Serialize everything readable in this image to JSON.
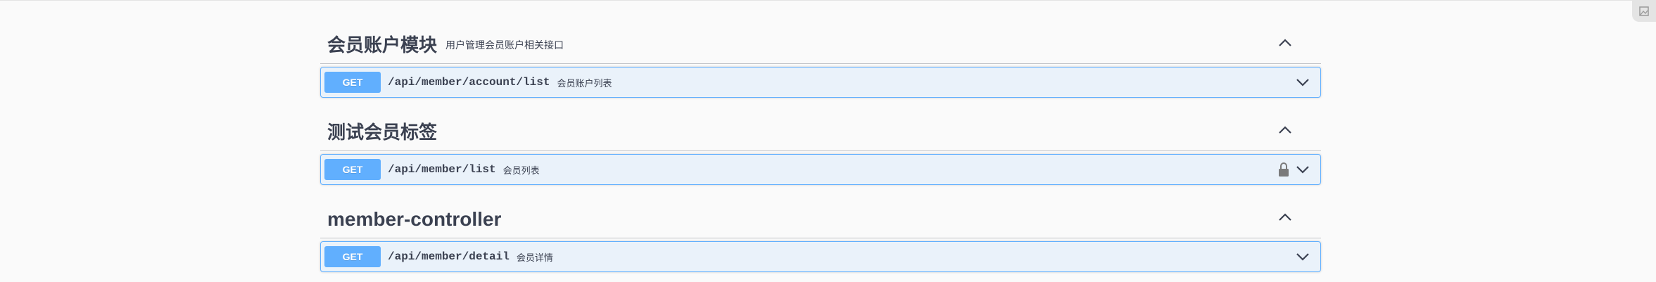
{
  "sections": [
    {
      "title": "会员账户模块",
      "description": "用户管理会员账户相关接口",
      "operations": [
        {
          "method": "GET",
          "path": "/api/member/account/list",
          "summary": "会员账户列表",
          "locked": false
        }
      ]
    },
    {
      "title": "测试会员标签",
      "description": "",
      "operations": [
        {
          "method": "GET",
          "path": "/api/member/list",
          "summary": "会员列表",
          "locked": true
        }
      ]
    },
    {
      "title": "member-controller",
      "description": "",
      "operations": [
        {
          "method": "GET",
          "path": "/api/member/detail",
          "summary": "会员详情",
          "locked": false
        }
      ]
    }
  ],
  "icons": {
    "collapse": "chevron-up-icon",
    "expand": "chevron-down-icon",
    "lock": "lock-icon",
    "corner": "image-icon"
  },
  "colors": {
    "get_method": "#61affe",
    "text": "#3b4151",
    "background": "#fafafa"
  }
}
